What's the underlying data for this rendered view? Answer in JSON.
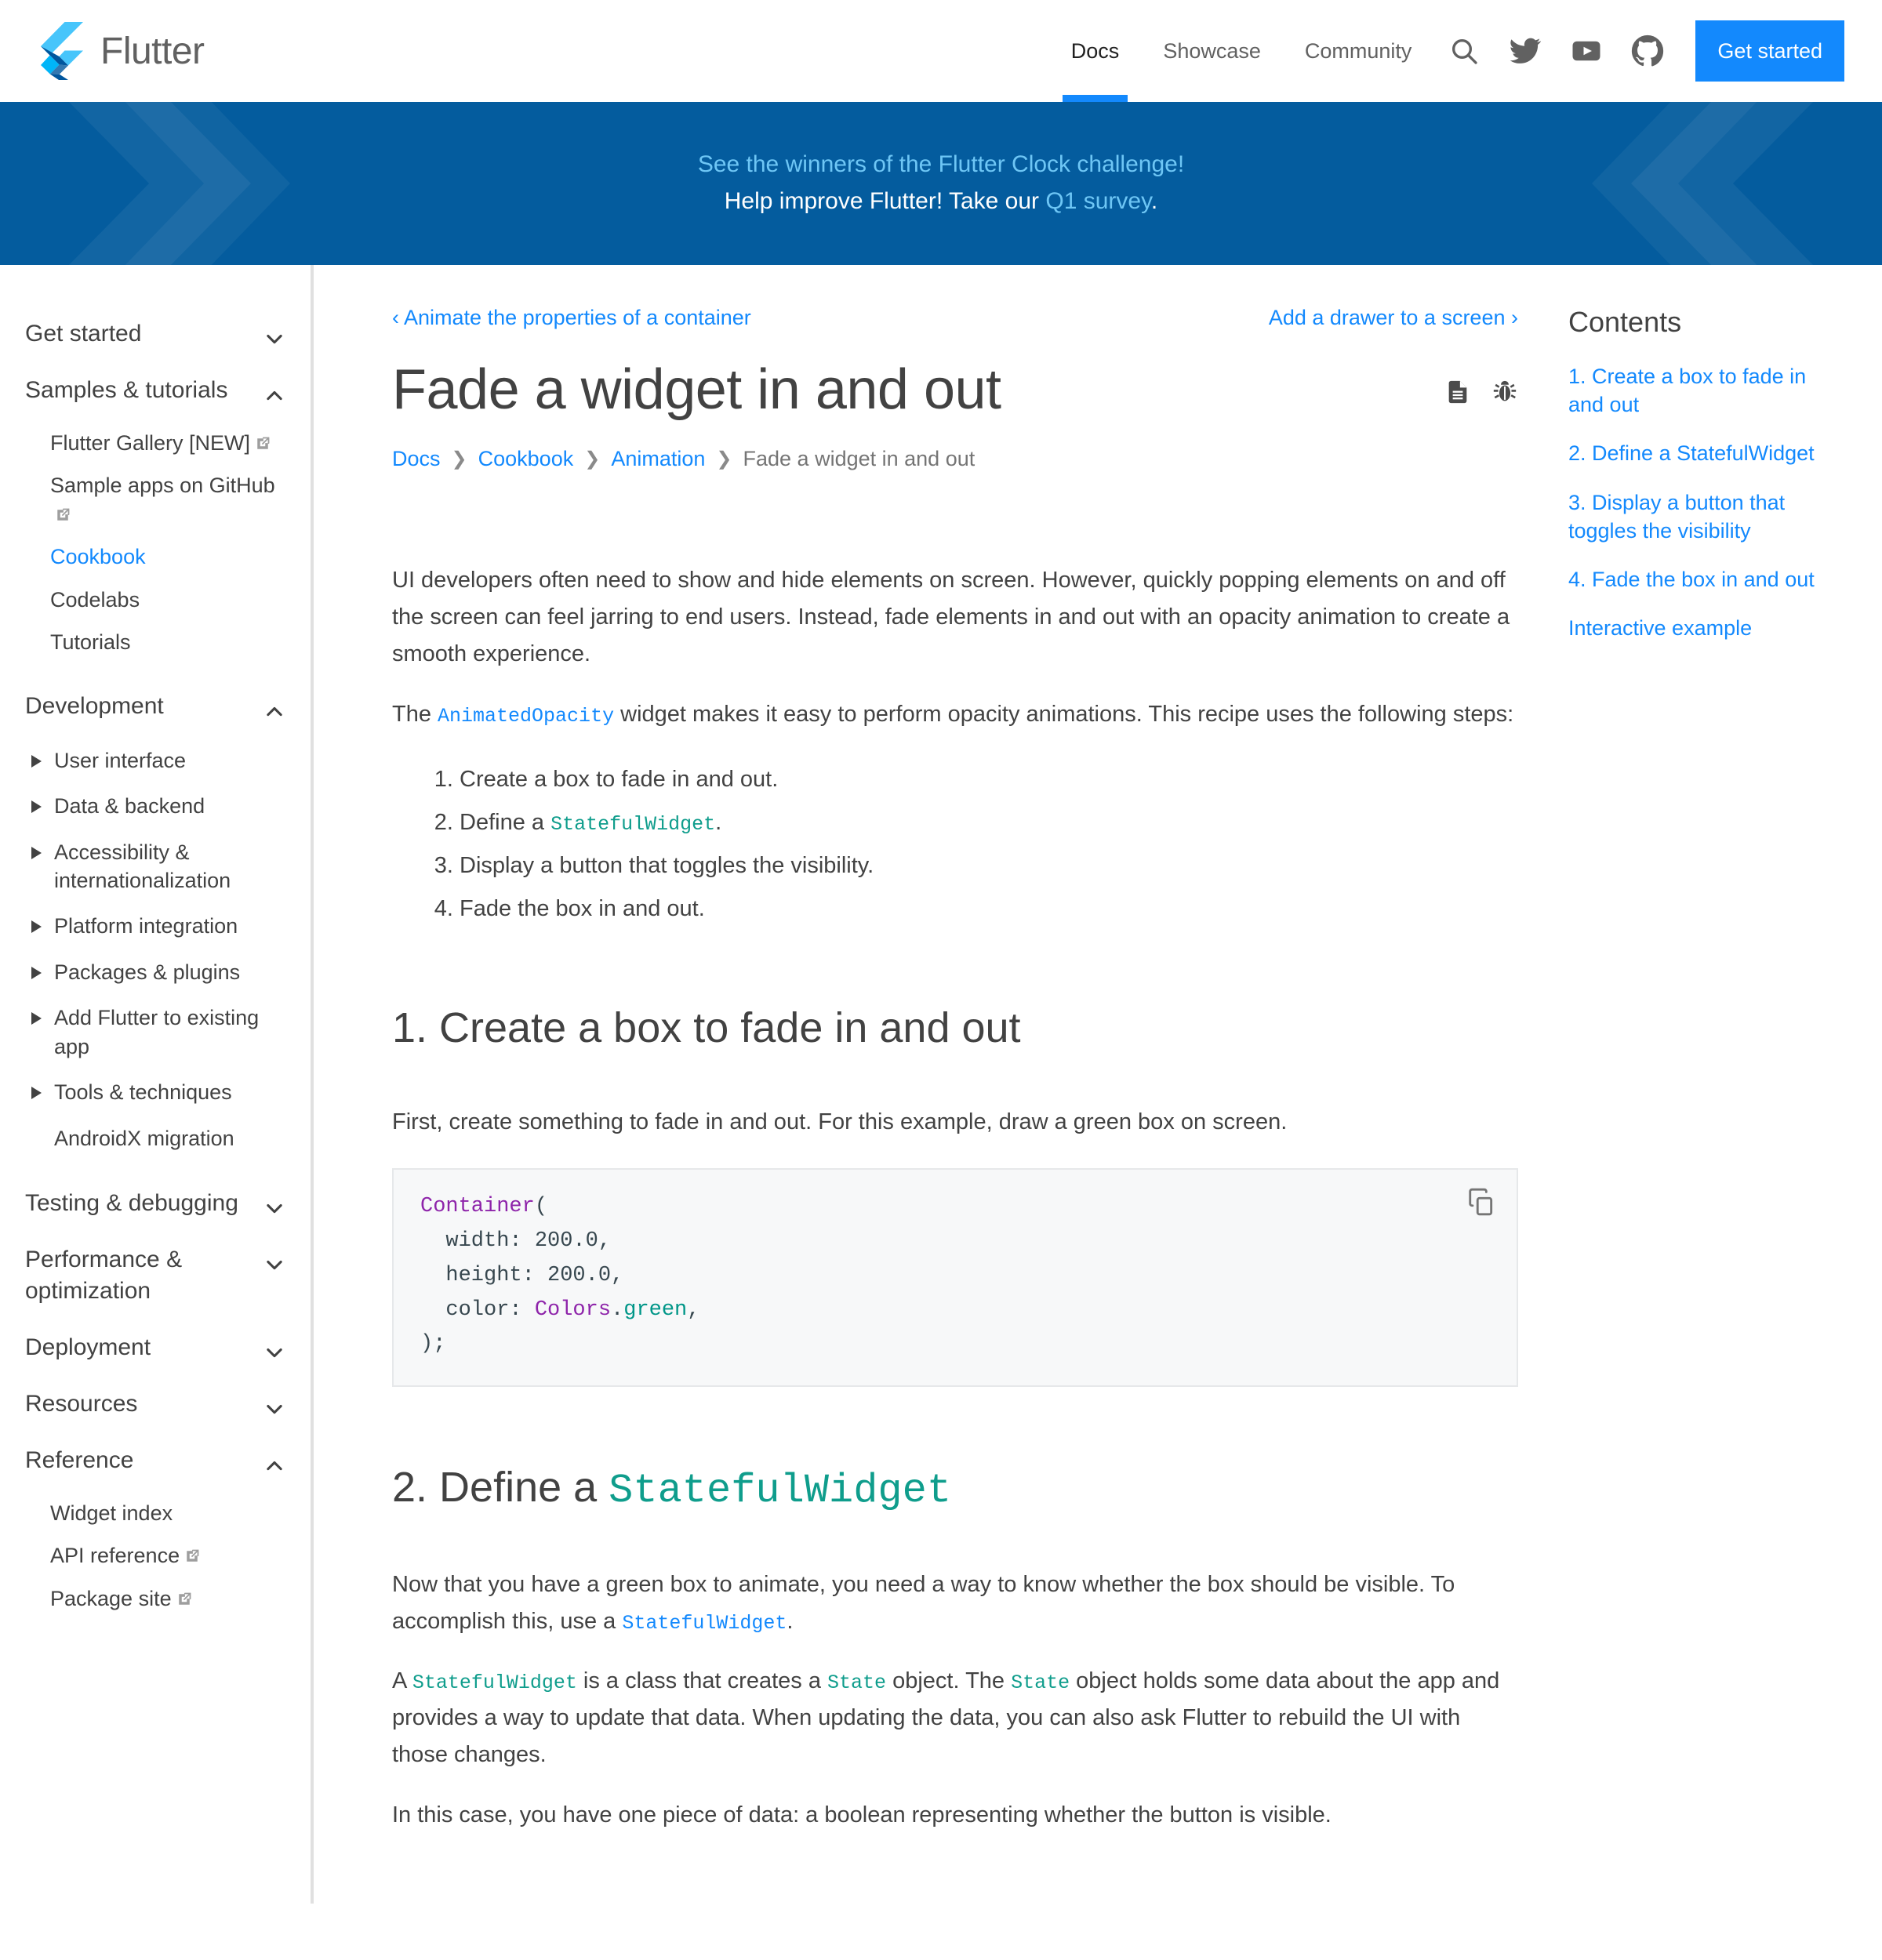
{
  "header": {
    "brand": "Flutter",
    "nav": [
      {
        "label": "Docs",
        "active": true
      },
      {
        "label": "Showcase",
        "active": false
      },
      {
        "label": "Community",
        "active": false
      }
    ],
    "icons": [
      "search-icon",
      "twitter-icon",
      "youtube-icon",
      "github-icon"
    ],
    "cta_label": "Get started",
    "accent": "#1389fd"
  },
  "banner": {
    "line1_text": "See the winners of the Flutter Clock challenge!",
    "line2_prefix": "Help improve Flutter! Take our ",
    "line2_link": "Q1 survey",
    "line2_suffix": ".",
    "bg": "#045c9e",
    "link_color": "#6ec6f5"
  },
  "sidebar": {
    "groups": [
      {
        "label": "Get started",
        "state": "collapsed",
        "items": []
      },
      {
        "label": "Samples & tutorials",
        "state": "expanded",
        "items": [
          {
            "label": "Flutter Gallery [NEW]",
            "external": true,
            "current": false
          },
          {
            "label": "Sample apps on GitHub",
            "external": true,
            "current": false
          },
          {
            "label": "Cookbook",
            "external": false,
            "current": true
          },
          {
            "label": "Codelabs",
            "external": false,
            "current": false
          },
          {
            "label": "Tutorials",
            "external": false,
            "current": false
          }
        ]
      },
      {
        "label": "Development",
        "state": "expanded",
        "expandables": [
          {
            "label": "User interface",
            "toggle": true
          },
          {
            "label": "Data & backend",
            "toggle": true
          },
          {
            "label": "Accessibility & internationalization",
            "toggle": true
          },
          {
            "label": "Platform integration",
            "toggle": true
          },
          {
            "label": "Packages & plugins",
            "toggle": true
          },
          {
            "label": "Add Flutter to existing app",
            "toggle": true
          },
          {
            "label": "Tools & techniques",
            "toggle": true
          },
          {
            "label": "AndroidX migration",
            "toggle": false
          }
        ]
      },
      {
        "label": "Testing & debugging",
        "state": "collapsed",
        "items": []
      },
      {
        "label": "Performance & optimization",
        "state": "collapsed",
        "items": []
      },
      {
        "label": "Deployment",
        "state": "collapsed",
        "items": []
      },
      {
        "label": "Resources",
        "state": "collapsed",
        "items": []
      },
      {
        "label": "Reference",
        "state": "expanded",
        "items": [
          {
            "label": "Widget index",
            "external": false,
            "current": false
          },
          {
            "label": "API reference",
            "external": true,
            "current": false
          },
          {
            "label": "Package site",
            "external": true,
            "current": false
          }
        ]
      }
    ]
  },
  "main": {
    "prev_link": "Animate the properties of a container",
    "prev_chevron": "‹",
    "next_link": "Add a drawer to a screen",
    "next_chevron": "›",
    "title": "Fade a widget in and out",
    "actions": [
      "document-icon",
      "bug-icon"
    ],
    "breadcrumb": [
      {
        "label": "Docs",
        "link": true
      },
      {
        "label": "Cookbook",
        "link": true
      },
      {
        "label": "Animation",
        "link": true
      },
      {
        "label": "Fade a widget in and out",
        "link": false
      }
    ],
    "breadcrumb_sep": "❯",
    "intro_para": "UI developers often need to show and hide elements on screen. However, quickly popping elements on and off the screen can feel jarring to end users. Instead, fade elements in and out with an opacity animation to create a smooth experience.",
    "steps_intro_a": "The ",
    "steps_intro_code": "AnimatedOpacity",
    "steps_intro_b": " widget makes it easy to perform opacity animations. This recipe uses the following steps:",
    "steps": [
      {
        "text_a": "Create a box to fade in and out.",
        "code": "",
        "text_b": ""
      },
      {
        "text_a": "Define a ",
        "code": "StatefulWidget",
        "text_b": "."
      },
      {
        "text_a": "Display a button that toggles the visibility.",
        "code": "",
        "text_b": ""
      },
      {
        "text_a": "Fade the box in and out.",
        "code": "",
        "text_b": ""
      }
    ],
    "section1_heading": "1. Create a box to fade in and out",
    "section1_para": "First, create something to fade in and out. For this example, draw a green box on screen.",
    "code_block": {
      "copy_label": "copy-icon",
      "lines": [
        [
          {
            "t": "Container",
            "c": "cls"
          },
          {
            "t": "(",
            "c": "plain"
          }
        ],
        [
          {
            "t": "  width: 200.0,",
            "c": "plain"
          }
        ],
        [
          {
            "t": "  height: 200.0,",
            "c": "plain"
          }
        ],
        [
          {
            "t": "  color: ",
            "c": "plain"
          },
          {
            "t": "Colors",
            "c": "cls"
          },
          {
            "t": ".",
            "c": "plain"
          },
          {
            "t": "green",
            "c": "green"
          },
          {
            "t": ",",
            "c": "plain"
          }
        ],
        [
          {
            "t": ");",
            "c": "plain"
          }
        ]
      ]
    },
    "section2_heading_a": "2. Define a ",
    "section2_heading_code": "StatefulWidget",
    "section2_para1_a": "Now that you have a green box to animate, you need a way to know whether the box should be visible. To accomplish this, use a ",
    "section2_para1_code": "StatefulWidget",
    "section2_para1_b": ".",
    "section2_para2_a": "A ",
    "section2_para2_c1": "StatefulWidget",
    "section2_para2_b": " is a class that creates a ",
    "section2_para2_c2": "State",
    "section2_para2_d": " object. The ",
    "section2_para2_c3": "State",
    "section2_para2_e": " object holds some data about the app and provides a way to update that data. When updating the data, you can also ask Flutter to rebuild the UI with those changes.",
    "section2_para3": "In this case, you have one piece of data: a boolean representing whether the button is visible."
  },
  "toc": {
    "title": "Contents",
    "items": [
      "1. Create a box to fade in and out",
      "2. Define a StatefulWidget",
      "3. Display a button that toggles the visibility",
      "4. Fade the box in and out",
      "Interactive example"
    ]
  }
}
